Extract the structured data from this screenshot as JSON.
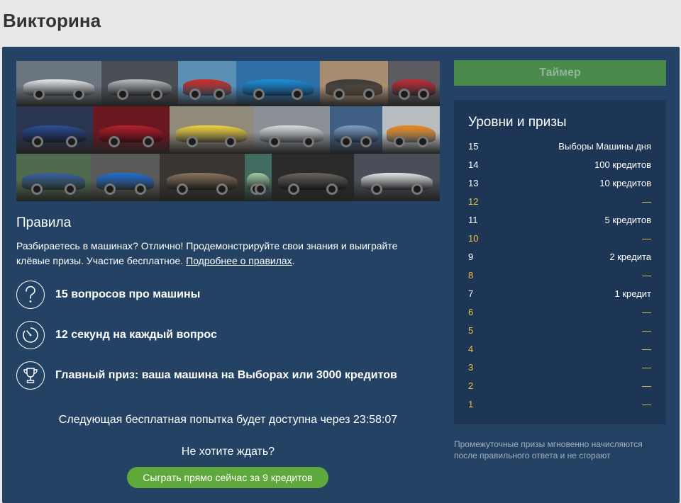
{
  "page": {
    "title": "Викторина"
  },
  "rules": {
    "title": "Правила",
    "text": "Разбираетесь в машинах? Отлично! Продемонстрируйте свои знания и выиграйте клёвые призы. Участие бесплатное. ",
    "link": "Подробнее о правилах",
    "text_end": "."
  },
  "features": [
    {
      "icon": "question-icon",
      "label": "15 вопросов про машины"
    },
    {
      "icon": "stopwatch-icon",
      "label": "12 секунд на каждый вопрос"
    },
    {
      "icon": "trophy-icon",
      "label": "Главный приз: ваша машина на Выборах или 3000 кредитов"
    }
  ],
  "next_try": "Следующая бесплатная попытка будет доступна через 23:58:07",
  "no_wait": "Не хотите ждать?",
  "play_button": "Сыграть прямо сейчас за 9 кредитов",
  "timer_button": "Таймер",
  "levels": {
    "title": "Уровни и призы",
    "rows": [
      {
        "n": "15",
        "prize": "Выборы Машины дня",
        "state": "win"
      },
      {
        "n": "14",
        "prize": "100 кредитов",
        "state": "win"
      },
      {
        "n": "13",
        "prize": "10 кредитов",
        "state": "win"
      },
      {
        "n": "12",
        "prize": "—",
        "state": "empty"
      },
      {
        "n": "11",
        "prize": "5 кредитов",
        "state": "win"
      },
      {
        "n": "10",
        "prize": "—",
        "state": "empty"
      },
      {
        "n": "9",
        "prize": "2 кредита",
        "state": "win"
      },
      {
        "n": "8",
        "prize": "—",
        "state": "empty"
      },
      {
        "n": "7",
        "prize": "1 кредит",
        "state": "win"
      },
      {
        "n": "6",
        "prize": "—",
        "state": "empty"
      },
      {
        "n": "5",
        "prize": "—",
        "state": "empty"
      },
      {
        "n": "4",
        "prize": "—",
        "state": "empty"
      },
      {
        "n": "3",
        "prize": "—",
        "state": "empty"
      },
      {
        "n": "2",
        "prize": "—",
        "state": "empty"
      },
      {
        "n": "1",
        "prize": "—",
        "state": "empty"
      }
    ]
  },
  "footnote": "Промежуточные призы мгновенно начисляются после правильного ответа и не сгорают",
  "colors": {
    "panel": "#244264",
    "levels_bg": "#1d3656",
    "accent_green": "#5fa83c",
    "timer_green": "#4a8a4d",
    "level_empty": "#f0c040"
  },
  "collage": [
    {
      "name": "photo-white-seat",
      "bg": "#6a7580",
      "car": "#e8e8ea"
    },
    {
      "name": "photo-silver-audi",
      "bg": "#4a4f55",
      "car": "#b9bec4"
    },
    {
      "name": "photo-red-cartoon-car",
      "bg": "#5b8fb5",
      "car": "#d42a22"
    },
    {
      "name": "photo-blue-bugatti",
      "bg": "#2e6fa8",
      "car": "#1f8fd8"
    },
    {
      "name": "photo-side-mirror",
      "bg": "#a88d70",
      "car": "#3a3a3a"
    },
    {
      "name": "photo-red-headlight",
      "bg": "#5a5a60",
      "car": "#c42a36"
    },
    {
      "name": "photo-blue-bmw",
      "bg": "#2a3550",
      "car": "#2c4f95"
    },
    {
      "name": "photo-red-range-rover",
      "bg": "#6a1820",
      "car": "#b52230"
    },
    {
      "name": "photo-yellow-corvette",
      "bg": "#8f8a7a",
      "car": "#f2d43a"
    },
    {
      "name": "photo-white-golf",
      "bg": "#8a9096",
      "car": "#d9dcde"
    },
    {
      "name": "photo-city-aerial",
      "bg": "#3f5f85",
      "car": "#7d9ec0"
    },
    {
      "name": "photo-orange-mclaren",
      "bg": "#b7bcc0",
      "car": "#ef8a18"
    },
    {
      "name": "photo-man-blue-car",
      "bg": "#4f6a4c",
      "car": "#3a5fa0"
    },
    {
      "name": "photo-blue-bmw-m",
      "bg": "#5a5a58",
      "car": "#1f6fd6"
    },
    {
      "name": "photo-car-interior",
      "bg": "#3a3530",
      "car": "#8a7560"
    },
    {
      "name": "photo-green-retro-car",
      "bg": "#3f6b60",
      "car": "#a8c8a0"
    },
    {
      "name": "photo-steering-wheel",
      "bg": "#2a2a2a",
      "car": "#6a6560"
    },
    {
      "name": "photo-white-audi-q7",
      "bg": "#4a4e58",
      "car": "#e6e8ea"
    }
  ]
}
